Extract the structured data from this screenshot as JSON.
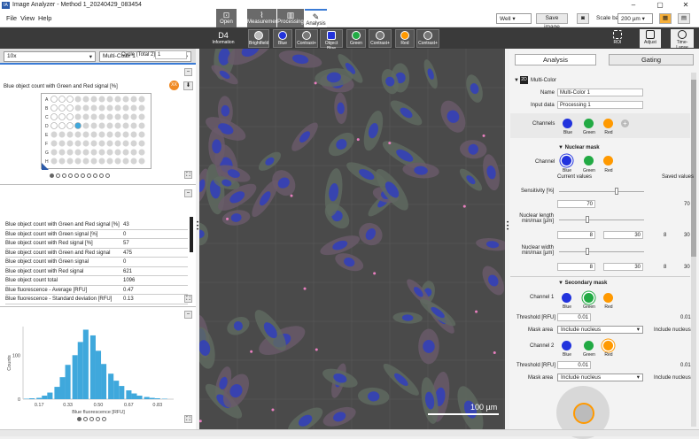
{
  "window": {
    "title": "Image Analyzer - Method 1_20240429_083454",
    "icon": "app-icon",
    "min": "–",
    "max": "▢",
    "close": "✕"
  },
  "menu": {
    "file": "File",
    "view": "View",
    "help": "Help"
  },
  "modes": [
    {
      "label": "Open",
      "icon": "open-icon"
    },
    {
      "label": "Measurement",
      "icon": "chart-icon"
    },
    {
      "label": "Processing",
      "icon": "processing-icon"
    },
    {
      "label": "Analysis",
      "icon": "brush-icon"
    }
  ],
  "top_right": {
    "display": "Well",
    "save_image": "Save image",
    "camera_icon": "camera-icon",
    "scale_bar_label": "Scale bar",
    "scale_bar_value": "200 µm",
    "grid_icon": "grid-icon",
    "layout_icon": "layout-icon"
  },
  "toolbar": {
    "well_id": "D4",
    "well_sub": "Information",
    "brightfield": "Brightfield",
    "blue": "Blue",
    "contrast": "Contrast+",
    "object_blue": "Object Blue",
    "green": "Green",
    "red": "Red",
    "roi": "ROI",
    "adjust": "Adjust",
    "timelapse": "Time-Lapse"
  },
  "left": {
    "objective": "10x",
    "method": "Multi-Color 1",
    "cycle_label": "Cycle (Total 2)",
    "cycle_value": "1",
    "plot_title": "Blue object count with Green and Red signal [%]",
    "rows_letters": [
      "A",
      "B",
      "C",
      "D",
      "E",
      "F",
      "G",
      "H"
    ],
    "selected_well": "D4",
    "table": [
      {
        "k": "Blue object count with Green and Red signal [%]",
        "v": "43"
      },
      {
        "k": "Blue object count with Green signal [%]",
        "v": "0"
      },
      {
        "k": "Blue object count with Red signal [%]",
        "v": "57"
      },
      {
        "k": "Blue object count with Green and Red signal",
        "v": "475"
      },
      {
        "k": "Blue object count with Green signal",
        "v": "0"
      },
      {
        "k": "Blue object count with Red signal",
        "v": "621"
      },
      {
        "k": "Blue object count total",
        "v": "1096"
      },
      {
        "k": "Blue fluorescence - Average [RFU]",
        "v": "0.47"
      },
      {
        "k": "Blue fluorescence - Standard deviation [RFU]",
        "v": "0.13"
      }
    ]
  },
  "chart_data": {
    "type": "bar",
    "title": "",
    "xlabel": "Blue fluorescence [RFU]",
    "ylabel": "Counts",
    "x": [
      0.1,
      0.13,
      0.17,
      0.2,
      0.23,
      0.27,
      0.3,
      0.33,
      0.37,
      0.4,
      0.43,
      0.47,
      0.5,
      0.53,
      0.57,
      0.6,
      0.63,
      0.67,
      0.7,
      0.73,
      0.77,
      0.8,
      0.83,
      0.87
    ],
    "values": [
      1,
      2,
      3,
      8,
      15,
      28,
      50,
      78,
      100,
      130,
      158,
      145,
      110,
      80,
      58,
      42,
      30,
      20,
      13,
      8,
      5,
      3,
      2,
      1
    ],
    "xticks": [
      "0.17",
      "0.33",
      "0.50",
      "0.67",
      "0.83"
    ],
    "yticks": [
      "0",
      "100"
    ],
    "ylim": [
      0,
      165
    ],
    "xlim": [
      0.08,
      0.92
    ],
    "bar_color": "#3fa8dc"
  },
  "image": {
    "scale_label": "100 µm"
  },
  "right": {
    "tab_analysis": "Analysis",
    "tab_gating": "Gating",
    "mode": "Multi-Color",
    "name_label": "Name",
    "name_value": "Multi-Color 1",
    "input_label": "Input data",
    "input_value": "Processing 1",
    "channels_label": "Channels",
    "blue": "Blue",
    "green": "Green",
    "red": "Red",
    "nuclear_title": "Nuclear mask",
    "channel_label": "Channel",
    "current_values": "Current values",
    "saved_values": "Saved values",
    "sensitivity_label": "Sensitivity [%]",
    "sensitivity": "70",
    "sensitivity_saved": "70",
    "nl_label": "Nuclear length min/max [µm]",
    "nl_min": "8",
    "nl_max": "30",
    "nl_saved_min": "8",
    "nl_saved_max": "30",
    "nw_label": "Nuclear width min/max [µm]",
    "nw_min": "8",
    "nw_max": "30",
    "nw_saved_min": "8",
    "nw_saved_max": "30",
    "secondary_title": "Secondary mask",
    "channel1": "Channel 1",
    "channel2": "Channel 2",
    "threshold_label": "Threshold [RFU]",
    "threshold1": "0.01",
    "threshold1_saved": "0.01",
    "threshold2": "0.01",
    "threshold2_saved": "0.01",
    "mask_area_label": "Mask area",
    "mask_area": "Include nucleus",
    "mask_area_saved": "Include nucleus"
  },
  "colors": {
    "blue": "#2233dd",
    "green": "#22aa44",
    "red": "#ff9900",
    "accent": "#3a7bd5",
    "dark": "#3a3a3a"
  }
}
